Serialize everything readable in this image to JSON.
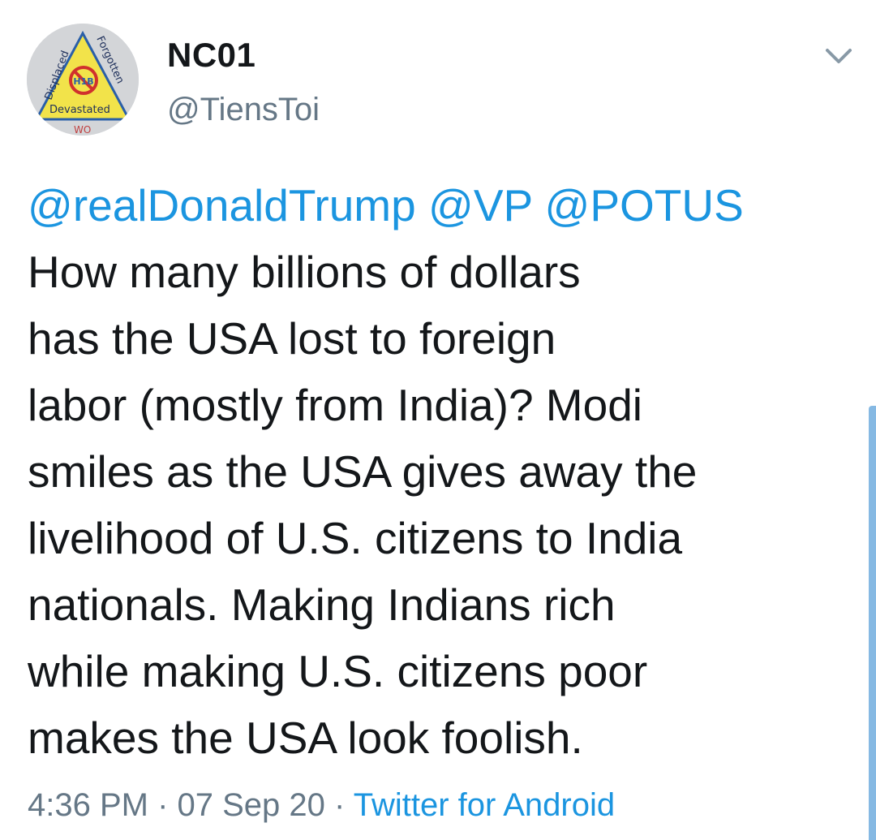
{
  "user": {
    "display_name": "NC01",
    "handle": "@TiensToi",
    "avatar": {
      "text_left": "Displaced",
      "text_right": "Forgotten",
      "text_bottom": "Devastated",
      "text_center": "H1B",
      "accent_color": "#f2e34a",
      "stroke_color": "#2a5fa8",
      "prohibit_color": "#d0312d"
    }
  },
  "tweet": {
    "mentions": [
      "@realDonaldTrump",
      "@VP",
      "@POTUS"
    ],
    "lines": [
      "How many billions of dollars",
      "has the USA lost to foreign",
      "labor (mostly from India)? Modi",
      "smiles as the USA gives away the",
      "livelihood of U.S. citizens to India",
      "nationals. Making Indians rich",
      "while making U.S. citizens poor",
      "makes the USA look foolish."
    ]
  },
  "meta": {
    "time": "4:36 PM",
    "separator": " · ",
    "date": "07 Sep 20",
    "source": "Twitter for Android"
  },
  "colors": {
    "link": "#1b95e0",
    "text": "#14171a",
    "muted": "#657786"
  },
  "icons": {
    "menu": "chevron-down-icon"
  }
}
